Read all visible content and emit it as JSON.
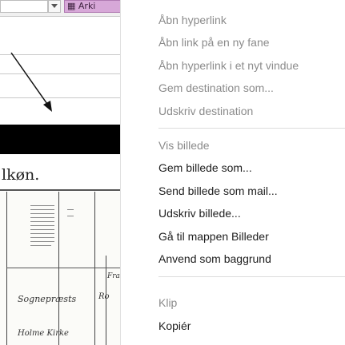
{
  "background_page": {
    "archive_button_label": "Arki",
    "page_title": "lkøn.",
    "handwriting": {
      "line1": "Sognepræsts",
      "line2": "Holme Kirke",
      "frag1": "Ro",
      "frag2": "Fra"
    }
  },
  "context_menu": {
    "items": [
      {
        "label": "Åbn hyperlink",
        "disabled": true
      },
      {
        "label": "Åbn link på en ny fane",
        "disabled": true
      },
      {
        "label": "Åbn hyperlink i et nyt vindue",
        "disabled": true
      },
      {
        "label": "Gem destination som...",
        "disabled": true
      },
      {
        "label": "Udskriv destination",
        "disabled": true
      },
      {
        "label": "Vis billede",
        "disabled": true
      },
      {
        "label": "Gem billede som...",
        "disabled": false
      },
      {
        "label": "Send billede som mail...",
        "disabled": false
      },
      {
        "label": "Udskriv billede...",
        "disabled": false
      },
      {
        "label": "Gå til mappen Billeder",
        "disabled": false
      },
      {
        "label": "Anvend som baggrund",
        "disabled": false
      },
      {
        "label": "Klip",
        "disabled": true
      },
      {
        "label": "Kopiér",
        "disabled": false
      }
    ]
  },
  "colors": {
    "menu_text": "#1e1e1e",
    "menu_text_disabled": "#8b8b8b",
    "archive_button": "#d7a8d8"
  }
}
